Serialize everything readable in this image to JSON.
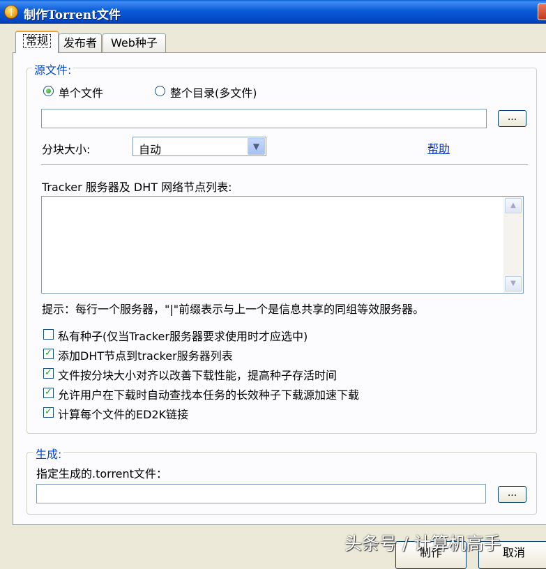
{
  "window": {
    "title": "制作Torrent文件"
  },
  "tabs": [
    {
      "label": "常规"
    },
    {
      "label": "发布者"
    },
    {
      "label": "Web种子"
    }
  ],
  "source": {
    "legend": "源文件:",
    "radio_single": "单个文件",
    "radio_dir": "整个目录(多文件)",
    "path_value": "",
    "browse_label": "...",
    "chunk_label": "分块大小:",
    "chunk_value": "自动",
    "help_link": "帮助",
    "tracker_label": "Tracker 服务器及 DHT 网络节点列表:",
    "tracker_value": "",
    "hint": "提示：每行一个服务器，\"|\"前缀表示与上一个是信息共享的同组等效服务器。",
    "options": [
      {
        "label": "私有种子(仅当Tracker服务器要求使用时才应选中)",
        "checked": false
      },
      {
        "label": "添加DHT节点到tracker服务器列表",
        "checked": true
      },
      {
        "label": "文件按分块大小对齐以改善下载性能，提高种子存活时间",
        "checked": true
      },
      {
        "label": "允许用户在下载时自动查找本任务的长效种子下载源加速下载",
        "checked": true
      },
      {
        "label": "计算每个文件的ED2K链接",
        "checked": true
      }
    ]
  },
  "output": {
    "legend": "生成:",
    "label": "指定生成的.torrent文件：",
    "path_value": "",
    "browse_label": "..."
  },
  "buttons": {
    "make": "制作",
    "cancel": "取消"
  },
  "watermark": "头条号 / 计算机高手",
  "colors": {
    "titlebar": "#0b5bd8",
    "legend": "#0046d5",
    "link": "#0033cc",
    "check": "#21a121"
  }
}
